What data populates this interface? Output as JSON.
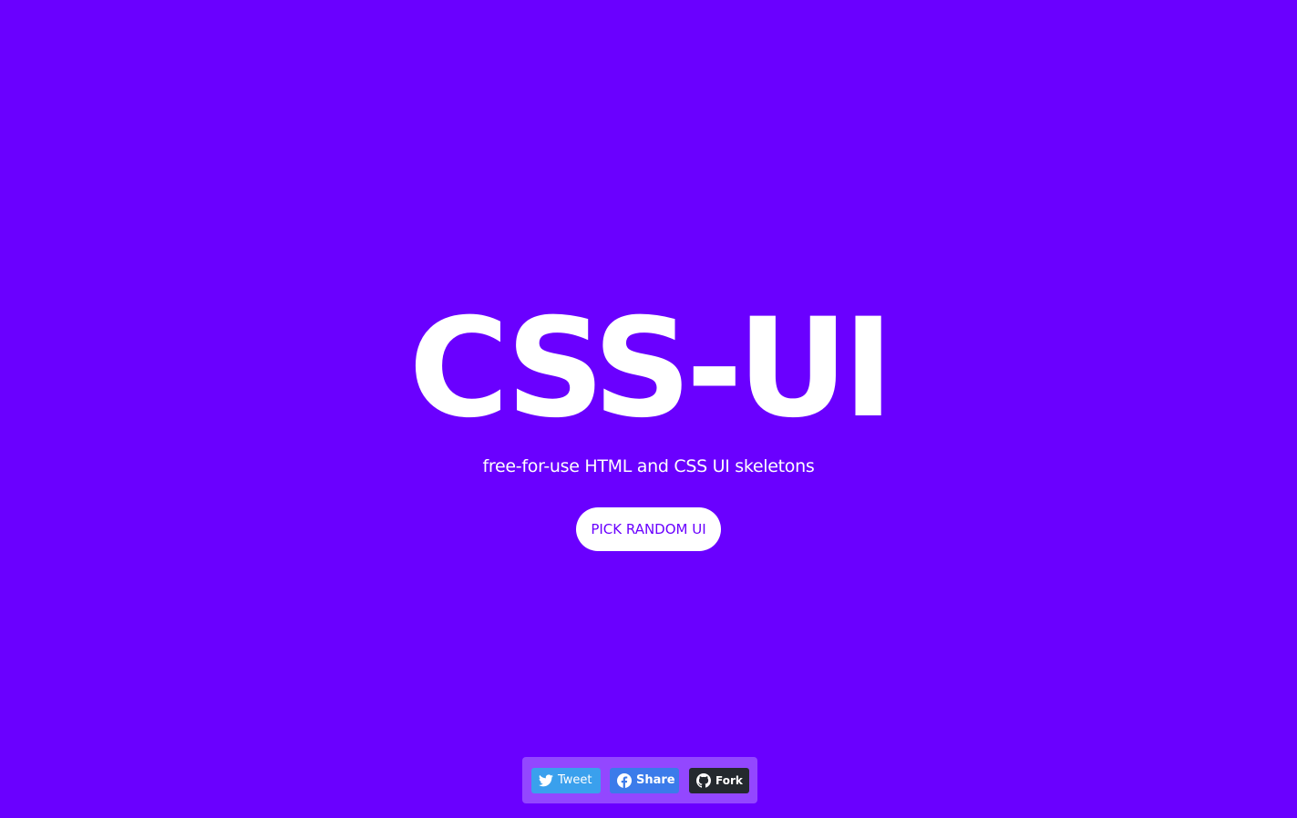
{
  "hero": {
    "title": "CSS-UI",
    "subtitle": "free-for-use HTML and CSS UI skeletons",
    "button_label": "PICK RANDOM UI"
  },
  "share_bar": {
    "tweet": {
      "label": "Tweet",
      "icon": "twitter-bird-icon"
    },
    "share": {
      "label": "Share",
      "icon": "facebook-icon"
    },
    "fork": {
      "label": "Fork",
      "icon": "github-icon"
    }
  },
  "colors": {
    "background": "#6a00ff",
    "title_text": "#ffffff",
    "button_bg": "#ffffff",
    "button_text": "#6a00ff",
    "tweet_bg": "#3aa0ed",
    "share_bg": "#3b7bea",
    "fork_bg": "#24292e"
  }
}
